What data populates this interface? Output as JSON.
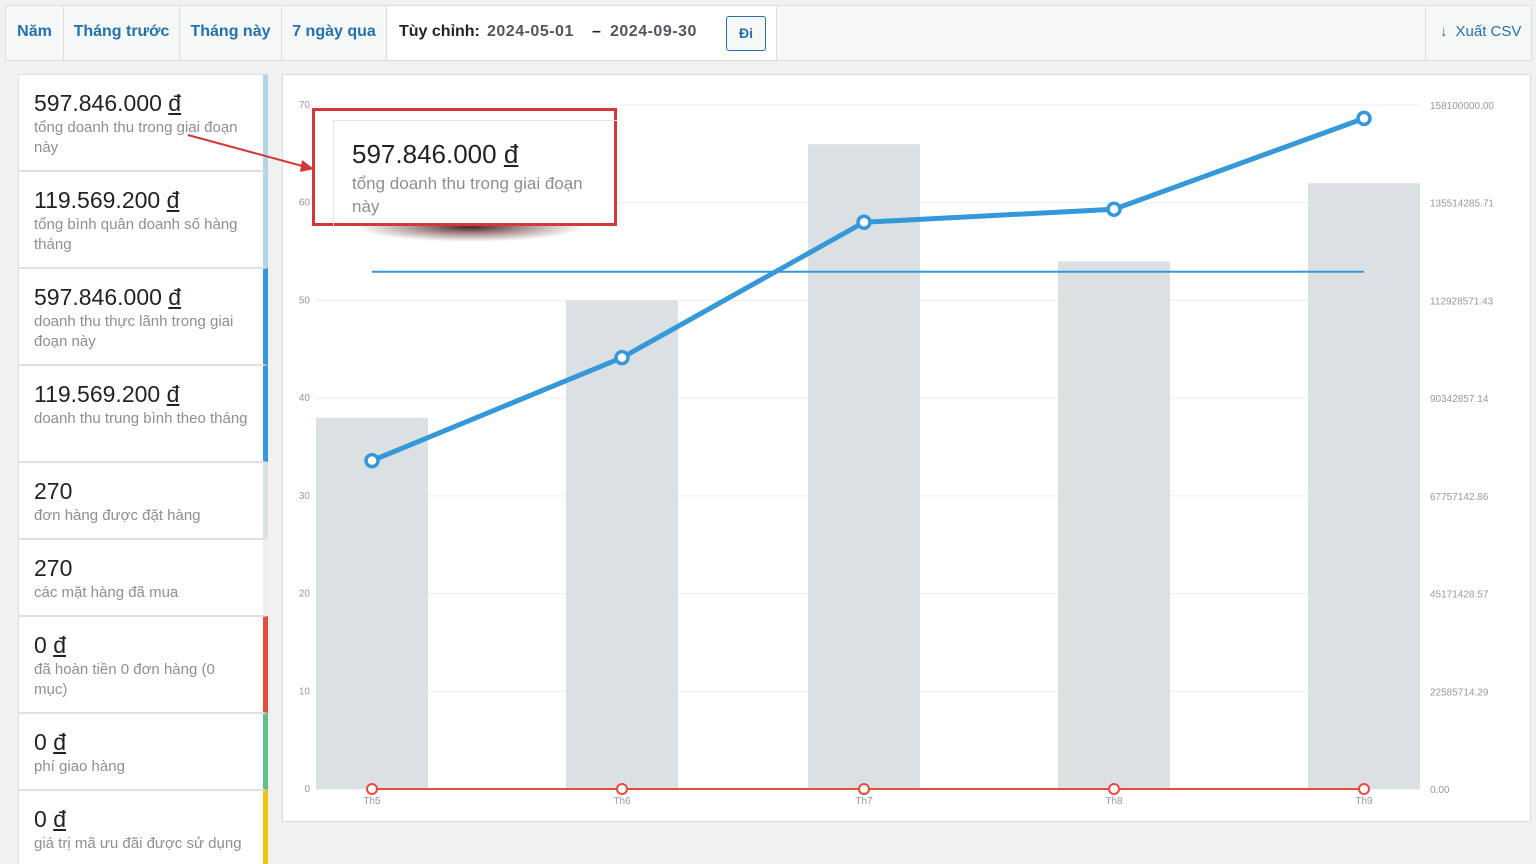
{
  "tabs": {
    "year": "Năm",
    "last_month": "Tháng trước",
    "this_month": "Tháng này",
    "last_7_days": "7 ngày qua",
    "custom_label": "Tùy chỉnh:",
    "date_from": "2024-05-01",
    "date_separator": "–",
    "date_to": "2024-09-30",
    "go_button": "Đi",
    "export_label": "Xuất CSV",
    "export_icon": "arrow-down-icon"
  },
  "legend": {
    "items": [
      {
        "amount": "597.846.000",
        "currency": "đ",
        "desc": "tổng doanh thu trong giai đoạn này",
        "color": "#b1d4ea"
      },
      {
        "amount": "119.569.200",
        "currency": "đ",
        "desc": "tổng bình quân doanh số hàng tháng",
        "color": "#b1d4ea"
      },
      {
        "amount": "597.846.000",
        "currency": "đ",
        "desc": "doanh thu thực lãnh trong giai đoạn này",
        "color": "#3498db"
      },
      {
        "amount": "119.569.200",
        "currency": "đ",
        "desc": "doanh thu trung bình theo tháng",
        "color": "#3498db"
      },
      {
        "amount": "270",
        "currency": "",
        "desc": "đơn hàng được đặt hàng",
        "color": "#dbe1e3"
      },
      {
        "amount": "270",
        "currency": "",
        "desc": "các mặt hàng đã mua",
        "color": "#ecf0f1"
      },
      {
        "amount": "0",
        "currency": "đ",
        "desc": "đã hoàn tiền 0 đơn hàng (0 mục)",
        "color": "#e74c3c"
      },
      {
        "amount": "0",
        "currency": "đ",
        "desc": "phí giao hàng",
        "color": "#5cc488"
      },
      {
        "amount": "0",
        "currency": "đ",
        "desc": "giá trị mã ưu đãi được sử dụng",
        "color": "#f1c40f"
      }
    ]
  },
  "callout": {
    "amount": "597.846.000",
    "currency": "đ",
    "desc": "tổng doanh thu trong giai đoạn này"
  },
  "chart_data": {
    "type": "bar",
    "categories": [
      "Th5",
      "Th6",
      "Th7",
      "Th8",
      "Th9"
    ],
    "ylim": [
      0,
      70
    ],
    "y_ticks": [
      "0",
      "10",
      "20",
      "30",
      "40",
      "50",
      "60",
      "70"
    ],
    "y2lim": [
      0,
      158100000
    ],
    "y2_ticks": [
      "0.00",
      "22585714.29",
      "45171428.57",
      "67757142.86",
      "90342857.14",
      "112928571.43",
      "135514285.71",
      "158100000.00"
    ],
    "grid": true,
    "series": [
      {
        "kind": "bar",
        "axis": "left",
        "values": [
          38,
          50,
          66,
          54,
          62
        ],
        "color": "#dbe1e3"
      },
      {
        "kind": "line",
        "axis": "right",
        "values": [
          75900000,
          99700000,
          131000000,
          134000000,
          155000000
        ],
        "color": "#3498db"
      },
      {
        "kind": "hline",
        "axis": "right",
        "values": [
          119569200
        ],
        "color": "#3498db"
      },
      {
        "kind": "line",
        "axis": "right",
        "values": [
          0,
          0,
          0,
          0,
          0
        ],
        "color": "#e74c3c"
      }
    ]
  }
}
